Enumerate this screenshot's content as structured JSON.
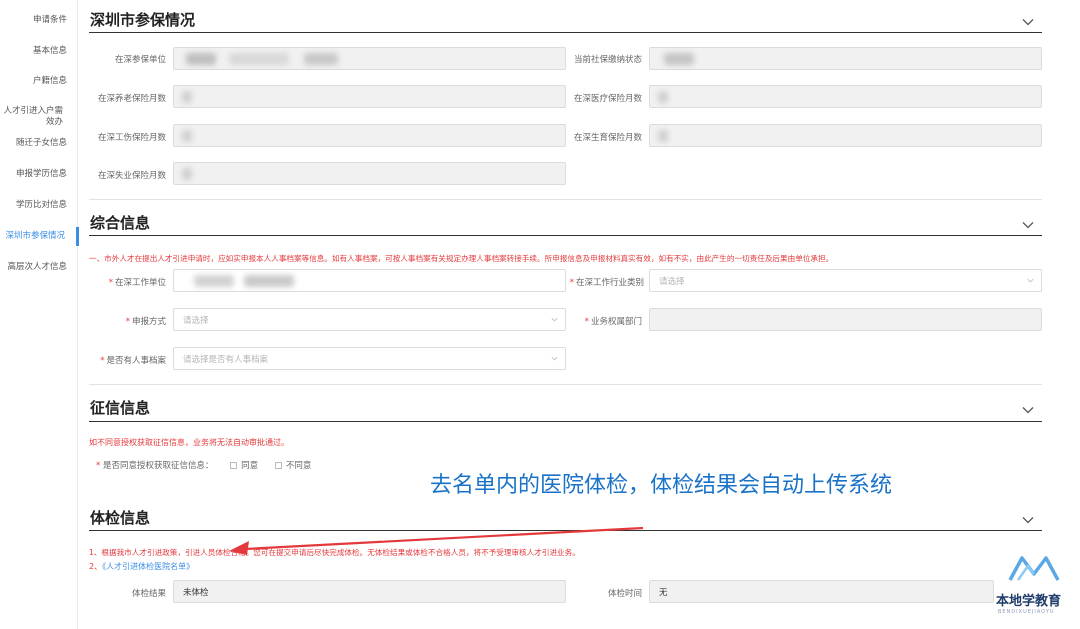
{
  "sidebar": {
    "items": [
      {
        "label": "申请条件"
      },
      {
        "label": "基本信息"
      },
      {
        "label": "户籍信息"
      },
      {
        "label": "人才引进入户需效办"
      },
      {
        "label": "随迁子女信息"
      },
      {
        "label": "申报学历信息"
      },
      {
        "label": "学历比对信息"
      },
      {
        "label": "深圳市参保情况",
        "active": true
      },
      {
        "label": "高层次人才信息"
      }
    ]
  },
  "insurance": {
    "title": "深圳市参保情况",
    "fields": {
      "employer_label": "在深参保单位",
      "status_label": "当前社保缴纳状态",
      "pension_label": "在深养老保险月数",
      "medical_label": "在深医疗保险月数",
      "injury_label": "在深工伤保险月数",
      "maternity_label": "在深生育保险月数",
      "unemployment_label": "在深失业保险月数"
    }
  },
  "general": {
    "title": "综合信息",
    "notice": "一、市外人才在提出人才引进申请时，应如实申报本人人事档案等信息。如有人事档案，可按人事档案有关规定办理人事档案转接手续。所申报信息及申报材料真实有效，如有不实，由此产生的一切责任及后果由单位承担。",
    "work_unit_label": "在深工作单位",
    "industry_label": "在深工作行业类别",
    "industry_placeholder": "请选择",
    "declare_label": "申报方式",
    "declare_placeholder": "请选择",
    "dept_label": "业务权属部门",
    "archive_label": "是否有人事档案",
    "archive_placeholder": "请选择是否有人事档案"
  },
  "credit": {
    "title": "征信信息",
    "notice": "如不同意授权获取征信信息，业务将无法自动审批通过。",
    "question": "是否同意授权获取征信信息：",
    "agree": "同意",
    "disagree": "不同意"
  },
  "annotation": {
    "callout": "去名单内的医院体检，体检结果会自动上传系统"
  },
  "medical": {
    "title": "体检信息",
    "notice1": "1、根据我市人才引进政策，引进人员体检合格。您可在提交申请后尽快完成体检。无体检结果或体检不合格人员，将不予受理审核人才引进业务。",
    "notice2_prefix": "2、",
    "notice2_link": "《人才引进体检医院名单》",
    "result_label": "体检结果",
    "result_value": "未体检",
    "time_label": "体检时间",
    "time_value": "无"
  },
  "logo": {
    "name": "本地学教育",
    "sub": "BENDIXUEJIAOYU"
  },
  "colors": {
    "accent": "#3a8ee6",
    "warning": "#e4393c",
    "callout": "#1a73c8"
  }
}
